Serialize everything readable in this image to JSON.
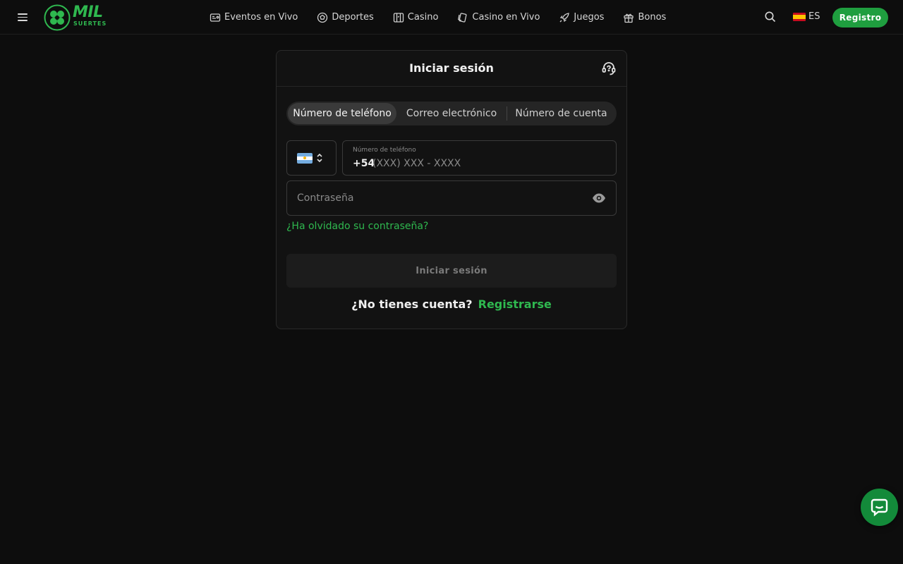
{
  "header": {
    "logo": {
      "word": "MIL",
      "sub": "SUERTES"
    },
    "nav": [
      {
        "label": "Eventos en Vivo",
        "icon": "live-tv-icon"
      },
      {
        "label": "Deportes",
        "icon": "soccer-ball-icon"
      },
      {
        "label": "Casino",
        "icon": "slot-machine-icon"
      },
      {
        "label": "Casino en Vivo",
        "icon": "cards-icon"
      },
      {
        "label": "Juegos",
        "icon": "rocket-icon"
      },
      {
        "label": "Bonos",
        "icon": "gift-icon"
      }
    ],
    "language": "ES",
    "register_label": "Registro"
  },
  "login": {
    "title": "Iniciar sesión",
    "tabs": [
      "Número de teléfono",
      "Correo electrónico",
      "Número de cuenta"
    ],
    "active_tab": 0,
    "phone": {
      "label": "Número de teléfono",
      "prefix": "+54",
      "placeholder": "(XXX) XXX - XXXX"
    },
    "password_placeholder": "Contraseña",
    "forgot_label": "¿Ha olvidado su contraseña?",
    "submit_label": "Iniciar sesión",
    "no_account": "¿No tienes cuenta?",
    "signup_label": "Registrarse"
  },
  "colors": {
    "accent": "#2fb84f",
    "button_green": "#1f9e3f",
    "background": "#0d0d0d",
    "card": "#121212"
  }
}
